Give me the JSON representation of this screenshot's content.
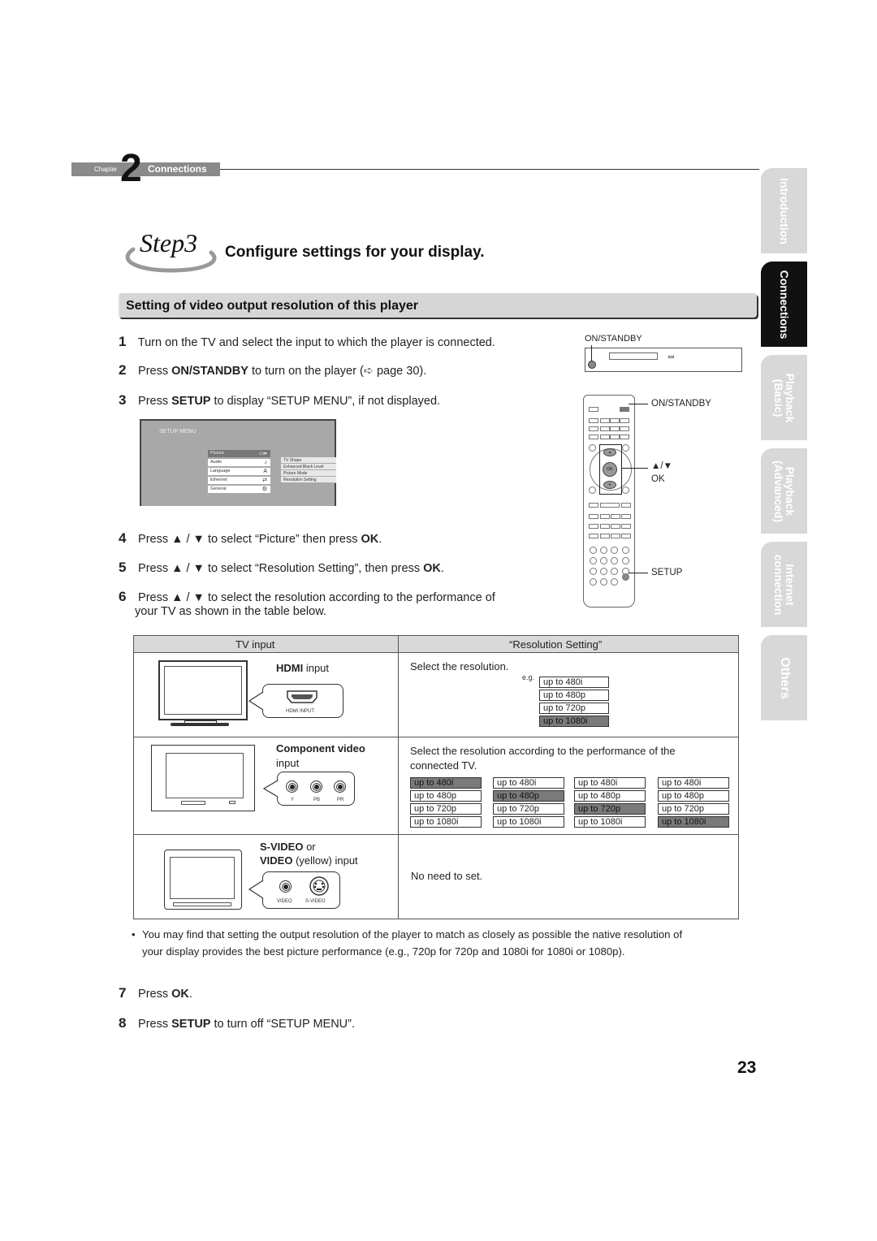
{
  "chapter": {
    "label": "Chapter",
    "number": "2",
    "title": "Connections"
  },
  "step": {
    "label": "Step3",
    "title": "Configure settings for your display."
  },
  "section": {
    "title": "Setting of video output resolution of this player"
  },
  "side_tabs": [
    {
      "label": "Introduction",
      "active": false
    },
    {
      "label": "Connections",
      "active": true
    },
    {
      "label": "Playback\n(Basic)",
      "active": false
    },
    {
      "label": "Playback\n(Advanced)",
      "active": false
    },
    {
      "label": "Internet\nconnection",
      "active": false
    },
    {
      "label": "Others",
      "active": false
    }
  ],
  "instructions": {
    "s1": {
      "num": "1",
      "text": "Turn on the TV and select the input to which the player is connected."
    },
    "s2": {
      "num": "2",
      "pre": "Press ",
      "bold": "ON/STANDBY",
      "post": " to turn on the player (",
      "ref_icon": "➪",
      "ref": " page 30)."
    },
    "s3": {
      "num": "3",
      "pre": "Press ",
      "bold": "SETUP",
      "post": " to display “SETUP MENU”, if not displayed."
    },
    "s4": {
      "num": "4",
      "pre": "Press ▲ / ▼ to select “Picture” then press ",
      "bold": "OK",
      "post": "."
    },
    "s5": {
      "num": "5",
      "pre": "Press ▲ / ▼ to select “Resolution Setting”, then press ",
      "bold": "OK",
      "post": "."
    },
    "s6": {
      "num": "6",
      "line1": "Press ▲ / ▼ to select the resolution according to the performance of",
      "line2": "your TV as shown in the table below."
    },
    "s7": {
      "num": "7",
      "pre": "Press ",
      "bold": "OK",
      "post": "."
    },
    "s8": {
      "num": "8",
      "pre": "Press ",
      "bold": "SETUP",
      "post": " to turn off “SETUP MENU”."
    }
  },
  "setup_menu": {
    "title": "SETUP MENU",
    "items": [
      {
        "label": "Picture",
        "icon": "▭▸",
        "selected": true
      },
      {
        "label": "Audio",
        "icon": "♪",
        "selected": false
      },
      {
        "label": "Language",
        "icon": "A",
        "selected": false
      },
      {
        "label": "Ethernet",
        "icon": "⇄",
        "selected": false
      },
      {
        "label": "General",
        "icon": "⚙",
        "selected": false
      }
    ],
    "submenu": [
      "TV Shape",
      "Enhanced Black Level",
      "Picture Mode",
      "Resolution Setting"
    ]
  },
  "device_figure": {
    "player_label": "ON/STANDBY",
    "remote_callouts": {
      "power": "ON/STANDBY",
      "arrows": "▲/▼",
      "ok": "OK",
      "setup": "SETUP"
    },
    "ok_button": "OK"
  },
  "table": {
    "headers": [
      "TV input",
      "“Resolution Setting”"
    ],
    "rows": [
      {
        "input_bold": "HDMI",
        "input_rest": " input",
        "port_label": "HDMI INPUT",
        "description": "Select the resolution.",
        "eg": "e.g.",
        "options": [
          {
            "label": "up to 480i",
            "selected": false
          },
          {
            "label": "up to 480p",
            "selected": false
          },
          {
            "label": "up to 720p",
            "selected": false
          },
          {
            "label": "up to 1080i",
            "selected": true
          }
        ]
      },
      {
        "input_bold": "Component video",
        "input_rest": "input",
        "jack_labels": [
          "Y",
          "PB",
          "PR"
        ],
        "description_line1": "Select the resolution according to the performance of the",
        "description_line2": "connected TV.",
        "option_columns": [
          {
            "options": [
              "up to 480i",
              "up to 480p",
              "up to 720p",
              "up to 1080i"
            ],
            "selected_index": 0
          },
          {
            "options": [
              "up to 480i",
              "up to 480p",
              "up to 720p",
              "up to 1080i"
            ],
            "selected_index": 1
          },
          {
            "options": [
              "up to 480i",
              "up to 480p",
              "up to 720p",
              "up to 1080i"
            ],
            "selected_index": 2
          },
          {
            "options": [
              "up to 480i",
              "up to 480p",
              "up to 720p",
              "up to 1080i"
            ],
            "selected_index": 3
          }
        ]
      },
      {
        "input_bold_1": "S-VIDEO",
        "input_rest_1": " or",
        "input_bold_2": "VIDEO",
        "input_rest_2": " (yellow) input",
        "jack_labels": [
          "VIDEO",
          "S-VIDEO"
        ],
        "description": "No need to set."
      }
    ]
  },
  "note": {
    "bullet": "•",
    "line1": "You may find that setting the output resolution of the player to match as closely as possible the native resolution of",
    "line2": "your display provides the best picture performance (e.g., 720p for 720p and 1080i for 1080i or 1080p)."
  },
  "page_number": "23"
}
